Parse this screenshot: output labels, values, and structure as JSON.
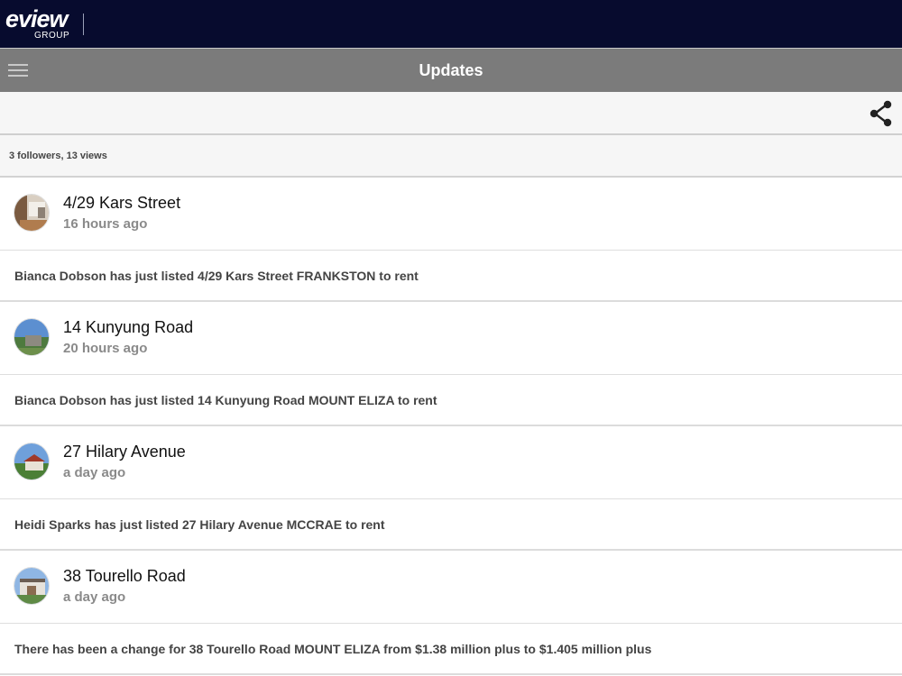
{
  "brand": {
    "name": "eview",
    "sub": "GROUP"
  },
  "header": {
    "title": "Updates"
  },
  "stats": {
    "text": "3 followers, 13 views"
  },
  "feed": [
    {
      "title": "4/29 Kars Street",
      "time": "16 hours ago",
      "text": "Bianca Dobson has just listed 4/29 Kars Street FRANKSTON to rent"
    },
    {
      "title": "14 Kunyung Road",
      "time": "20 hours ago",
      "text": "Bianca Dobson has just listed 14 Kunyung Road MOUNT ELIZA to rent"
    },
    {
      "title": "27 Hilary Avenue",
      "time": "a day ago",
      "text": "Heidi Sparks has just listed 27 Hilary Avenue MCCRAE to rent"
    },
    {
      "title": "38 Tourello Road",
      "time": "a day ago",
      "text": "There has been a change for 38 Tourello Road MOUNT ELIZA from $1.38 million plus to $1.405 million plus"
    }
  ],
  "icons": {
    "menu": "hamburger-menu-icon",
    "share": "share-icon"
  },
  "colors": {
    "brand_bar": "#070b2e",
    "title_bar": "#7b7b7b",
    "toolbar": "#f6f6f6"
  }
}
